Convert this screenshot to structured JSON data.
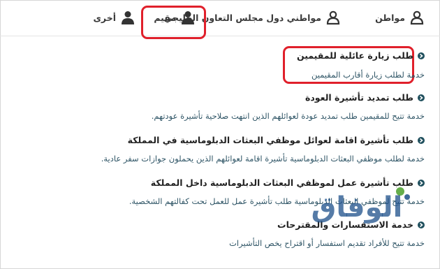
{
  "tabs": [
    {
      "label": "مواطن"
    },
    {
      "label": "مواطني دول مجلس التعاون الخليجي"
    },
    {
      "label": "مقيم"
    },
    {
      "label": "أخرى"
    }
  ],
  "services": [
    {
      "title": "طلب زيارة عائلية للمقيمين",
      "desc": "خدمة لطلب زيارة أقارب المقيمين"
    },
    {
      "title": "طلب تمديد تأشيرة العودة",
      "desc": "خدمة تتيح للمقيمين طلب تمديد عودة لعوائلهم الذين انتهت صلاحية تأشيرة عودتهم."
    },
    {
      "title": "طلب تأشيرة اقامة لعوائل موظفي البعثات الدبلوماسية في المملكة",
      "desc": "خدمة لطلب موظفي البعثات الدبلوماسية تأشيرة اقامة لعوائلهم الذين يحملون جوازات سفر عادية."
    },
    {
      "title": "طلب تأشيرة عمل لموظفي البعثات الدبلوماسية داخل المملكة",
      "desc": "خدمة تتيح لموظفي البعثات الدبلوماسية طلب تأشيرة عمل للعمل تحت كفالتهم الشخصية."
    },
    {
      "title": "خدمة الاستفسارات والمقترحات",
      "desc": "خدمة تتيح للأفراد تقديم استفسار أو اقتراح يخص التأشيرات"
    }
  ],
  "watermark": {
    "text": "الوفاق"
  },
  "colors": {
    "highlight": "#e0202b",
    "bullet": "#1f4f5d",
    "desc": "#2f5566",
    "watermark_green": "#4aa02c",
    "watermark_blue": "#1c4f8a"
  }
}
